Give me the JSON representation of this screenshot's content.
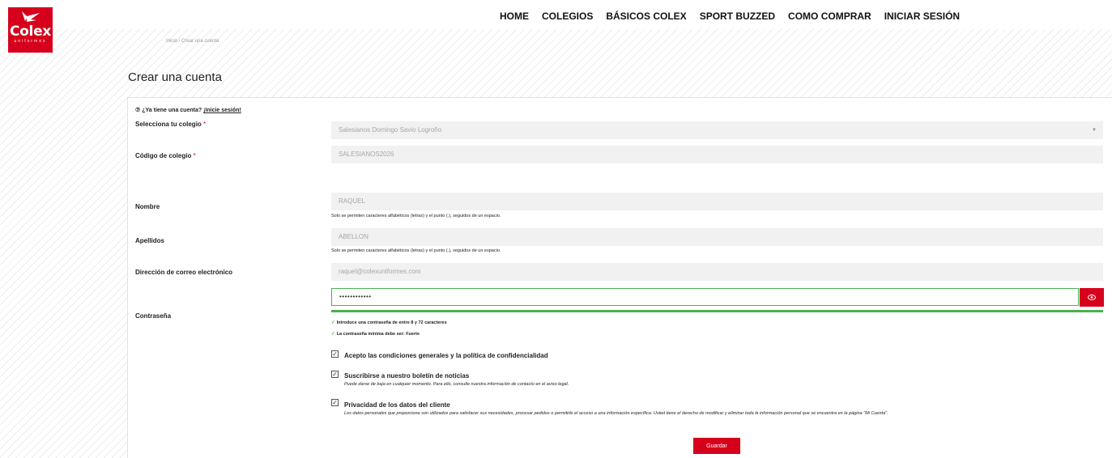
{
  "logo": {
    "brand": "Colex",
    "sub": "uniformes"
  },
  "nav": [
    "HOME",
    "COLEGIOS",
    "BÁSICOS COLEX",
    "SPORT BUZZED",
    "COMO COMPRAR",
    "INICIAR SESIÓN"
  ],
  "breadcrumb": "Inicio / Crear una cuenta",
  "page_title": "Crear una cuenta",
  "login_hint": {
    "prefix": "⑦ ¿Ya tiene una cuenta? ",
    "link": "¡Inicie sesión!"
  },
  "form": {
    "school": {
      "label": "Selecciona tu colegio",
      "value": "Salesianos Domingo Savio Logroño"
    },
    "code": {
      "label": "Código de colegio",
      "value": "SALESIANOS2026"
    },
    "first_name": {
      "label": "Nombre",
      "value": "RAQUEL",
      "help": "Solo se permiten caracteres alfabéticos (letras) y el punto (.), seguidos de un espacio."
    },
    "last_name": {
      "label": "Apellidos",
      "value": "ABELLON",
      "help": "Solo se permiten caracteres alfabéticos (letras) y el punto (.), seguidos de un espacio."
    },
    "email": {
      "label": "Dirección de correo electrónico",
      "value": "raquel@colexuniformes.com"
    },
    "password": {
      "label": "Contraseña",
      "value": "••••••••••••",
      "rules": [
        "Introduce una contraseña de entre 8 y 72 caracteres",
        "La contraseña mínima debe ser: Fuerte"
      ]
    },
    "terms": {
      "label": "Acepto las condiciones generales y la política de confidencialidad",
      "checked": true
    },
    "newsletter": {
      "label": "Suscribirse a nuestro boletín de noticias",
      "desc": "Puede darse de baja en cualquier momento. Para ello, consulte nuestra información de contacto en el aviso legal.",
      "checked": true
    },
    "privacy": {
      "label": "Privacidad de los datos del cliente",
      "desc": "Los datos personales que proporciona son utilizados para satisfacer sus necesidades, procesar pedidos o permitirle el acceso a una información específica. Usted tiene el derecho de modificar y eliminar toda la información personal que se encuentra en la página \"Mi Cuenta\".",
      "checked": true
    },
    "required_mark": "*",
    "check_mark": "✓",
    "save_label": "Guardar"
  },
  "colors": {
    "accent": "#d6001c",
    "success": "#4caf50"
  }
}
